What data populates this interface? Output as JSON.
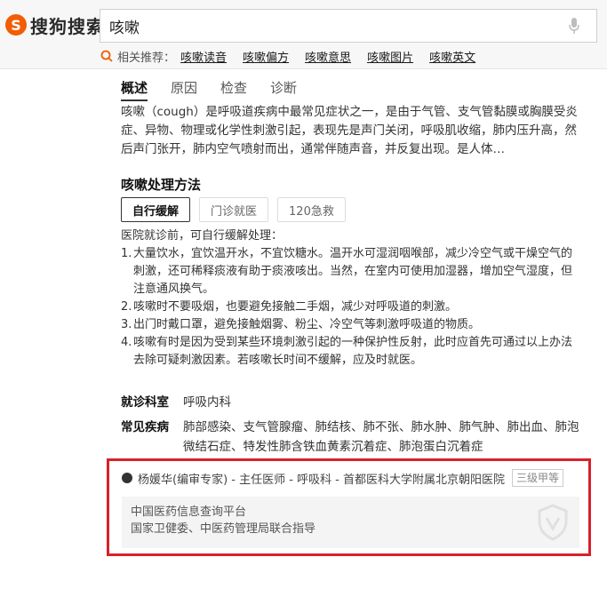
{
  "brand": {
    "name": "搜狗搜索",
    "mark": "S"
  },
  "search": {
    "query": "咳嗽"
  },
  "related": {
    "label": "相关推荐：",
    "items": [
      "咳嗽读音",
      "咳嗽偏方",
      "咳嗽意思",
      "咳嗽图片",
      "咳嗽英文"
    ]
  },
  "tabs": [
    "概述",
    "原因",
    "检查",
    "诊断"
  ],
  "overview": "咳嗽（cough）是呼吸道疾病中最常见症状之一，是由于气管、支气管黏膜或胸膜受炎症、异物、物理或化学性刺激引起，表现先是声门关闭，呼吸肌收缩，肺内压升高，然后声门张开，肺内空气喷射而出，通常伴随声音，并反复出现。是人体…",
  "treatment": {
    "title": "咳嗽处理方法",
    "tabs": [
      "自行缓解",
      "门诊就医",
      "120急救"
    ],
    "intro": "医院就诊前，可自行缓解处理：",
    "steps": [
      {
        "n": "1.",
        "text": "大量饮水，宜饮温开水，不宜饮糖水。温开水可湿润咽喉部，减少冷空气或干燥空气的刺激，还可稀释痰液有助于痰液咳出。当然，在室内可使用加湿器，增加空气湿度，但注意通风换气。"
      },
      {
        "n": "2.",
        "text": "咳嗽时不要吸烟，也要避免接触二手烟，减少对呼吸道的刺激。"
      },
      {
        "n": "3.",
        "text": "出门时戴口罩，避免接触烟雾、粉尘、冷空气等刺激呼吸道的物质。"
      },
      {
        "n": "4.",
        "text": "咳嗽有时是因为受到某些环境刺激引起的一种保护性反射，此时应首先可通过以上办法去除可疑刺激因素。若咳嗽长时间不缓解，应及时就医。"
      }
    ]
  },
  "department": {
    "label": "就诊科室",
    "value": "呼吸内科"
  },
  "diseases": {
    "label": "常见疾病",
    "value": "肺部感染、支气管腺瘤、肺结核、肺不张、肺水肿、肺气肿、肺出血、肺泡微结石症、特发性肺含铁血黄素沉着症、肺泡蛋白沉着症"
  },
  "source": {
    "expert": "杨媛华(编审专家) - 主任医师 - 呼吸科 - 首都医科大学附属北京朝阳医院",
    "badge": "三级甲等",
    "platform": "中国医药信息查询平台",
    "guide": "国家卫健委、中医药管理局联合指导",
    "highlight_color": "#d9202a"
  },
  "icons": [
    "mic-icon",
    "search-small-icon",
    "shield-icon"
  ]
}
